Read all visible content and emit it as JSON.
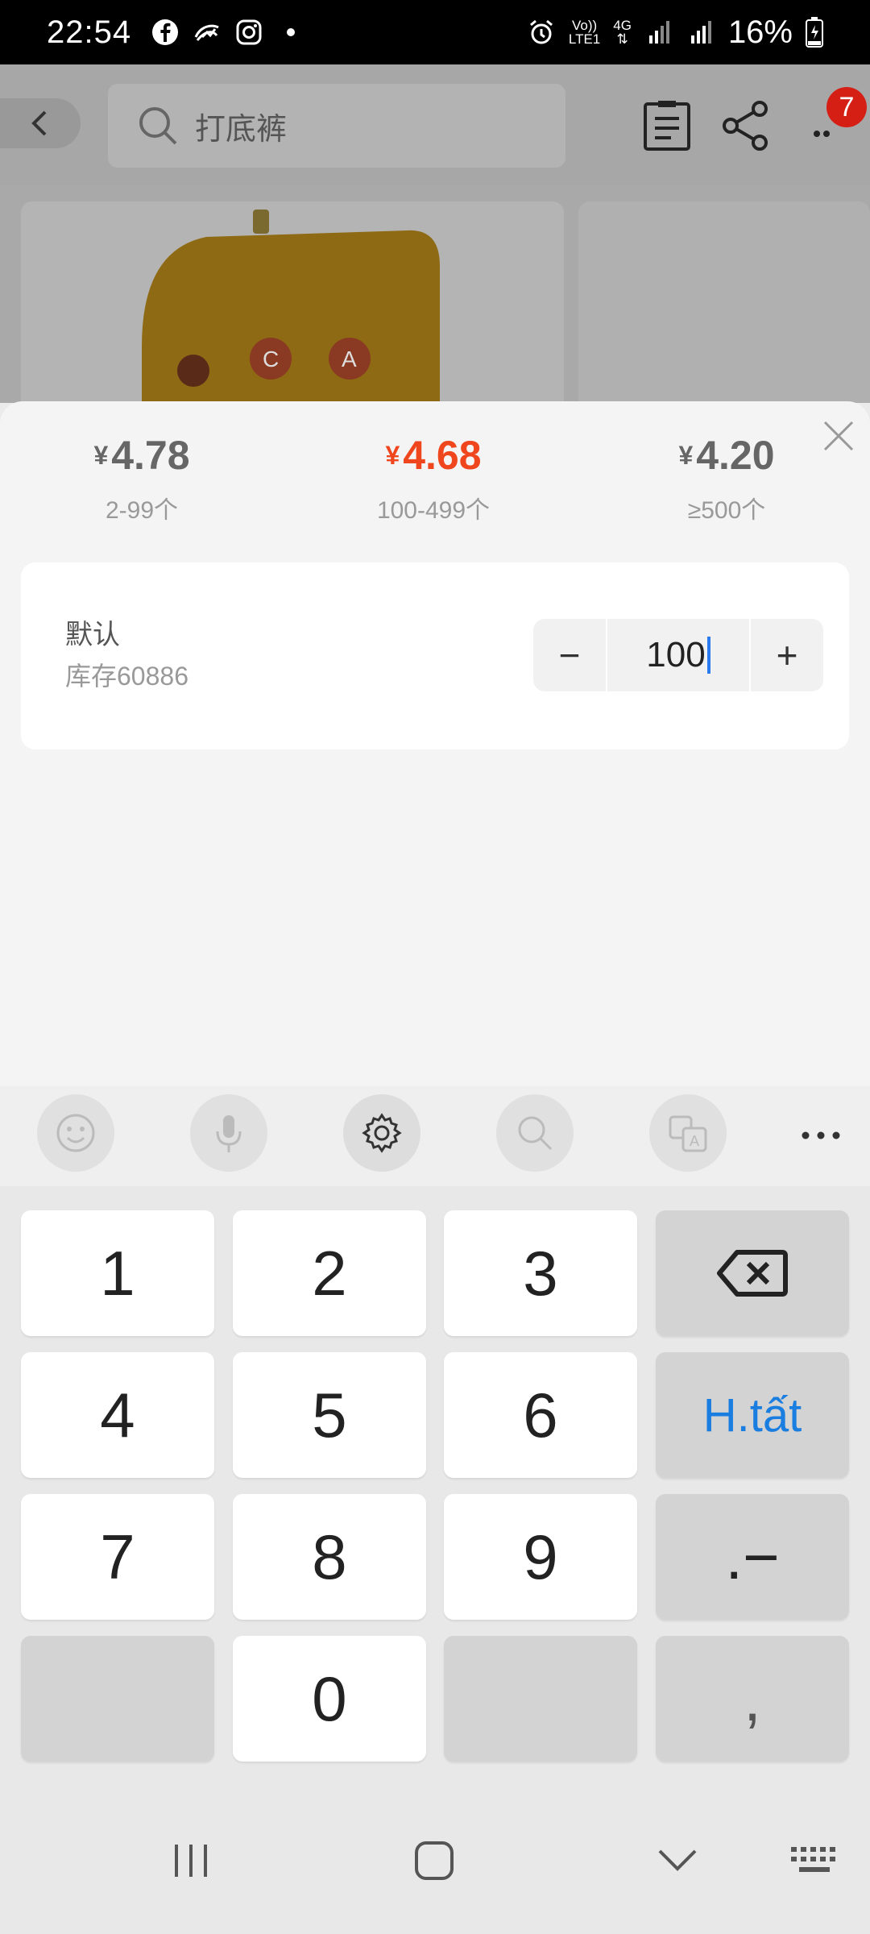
{
  "status_bar": {
    "time": "22:54",
    "network_top": "Vo))",
    "network_bottom": "LTE1",
    "gen": "4G",
    "battery": "16%",
    "icons_left": [
      "facebook-icon",
      "messenger-icon",
      "instagram-icon",
      "dot-icon"
    ],
    "icons_right": [
      "alarm-icon",
      "signal-icon",
      "signal-icon",
      "battery-icon"
    ]
  },
  "header": {
    "search_placeholder": "打底裤",
    "cart_badge": "7"
  },
  "sheet": {
    "tiers": [
      {
        "currency": "¥",
        "price": "4.78",
        "range": "2-99个",
        "active": false
      },
      {
        "currency": "¥",
        "price": "4.68",
        "range": "100-499个",
        "active": true
      },
      {
        "currency": "¥",
        "price": "4.20",
        "range": "≥500个",
        "active": false
      }
    ],
    "variant": {
      "name": "默认",
      "stock": "库存60886",
      "quantity": "100",
      "minus_label": "−",
      "plus_label": "+"
    }
  },
  "keyboard": {
    "toolbar": [
      "emoji-icon",
      "microphone-icon",
      "settings-icon",
      "search-icon",
      "translate-icon",
      "more-icon"
    ],
    "keys": {
      "k1": "1",
      "k2": "2",
      "k3": "3",
      "k4": "4",
      "k5": "5",
      "k6": "6",
      "k7": "7",
      "k8": "8",
      "k9": "9",
      "k0": "0",
      "done": "H.tất",
      "dot_dash": ".−",
      "comma": ","
    }
  },
  "colors": {
    "accent_price": "#f0461e",
    "done_blue": "#1a7de0",
    "caret": "#2a7bf0",
    "badge": "#d51f15"
  }
}
